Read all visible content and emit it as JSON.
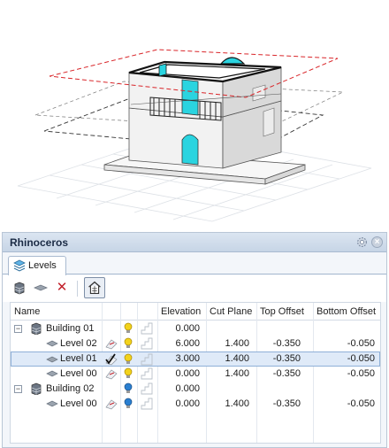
{
  "panel": {
    "title": "Rhinoceros",
    "close_glyph": "×",
    "tab_label": "Levels",
    "tab_icon": "levels-stack-icon"
  },
  "toolbar": {
    "items": [
      "new-building-icon",
      "new-level-icon",
      "delete-icon",
      "show-building-icon"
    ],
    "delete_glyph": "✕"
  },
  "table": {
    "headers": {
      "name": "Name",
      "elevation": "Elevation",
      "cut_plane": "Cut Plane",
      "top_offset": "Top Offset",
      "bottom_offset": "Bottom Offset"
    },
    "rows": [
      {
        "type": "building",
        "expander": "−",
        "name": "Building 01",
        "elevation": "0.000",
        "cut_plane": "",
        "top_offset": "",
        "bottom_offset": "",
        "bulb": "yellow"
      },
      {
        "type": "level",
        "name": "Level 02",
        "elevation": "6.000",
        "cut_plane": "1.400",
        "top_offset": "-0.350",
        "bottom_offset": "-0.050",
        "bulb": "yellow",
        "current": false
      },
      {
        "type": "level",
        "name": "Level 01",
        "elevation": "3.000",
        "cut_plane": "1.400",
        "top_offset": "-0.350",
        "bottom_offset": "-0.050",
        "bulb": "yellow",
        "current": true,
        "selected": true
      },
      {
        "type": "level",
        "name": "Level 00",
        "elevation": "0.000",
        "cut_plane": "1.400",
        "top_offset": "-0.350",
        "bottom_offset": "-0.050",
        "bulb": "yellow",
        "current": false
      },
      {
        "type": "building",
        "expander": "−",
        "name": "Building 02",
        "elevation": "0.000",
        "cut_plane": "",
        "top_offset": "",
        "bottom_offset": "",
        "bulb": "blue"
      },
      {
        "type": "level",
        "name": "Level 00",
        "elevation": "0.000",
        "cut_plane": "1.400",
        "top_offset": "-0.350",
        "bottom_offset": "-0.050",
        "bulb": "blue",
        "current": false
      }
    ]
  },
  "colors": {
    "accent_cyan": "#2ad4e0",
    "cut_plane_red": "#d9262a",
    "bulb_yellow": "#f2d21b",
    "bulb_blue": "#2a7fd0",
    "selection": "#dfeaf8"
  }
}
